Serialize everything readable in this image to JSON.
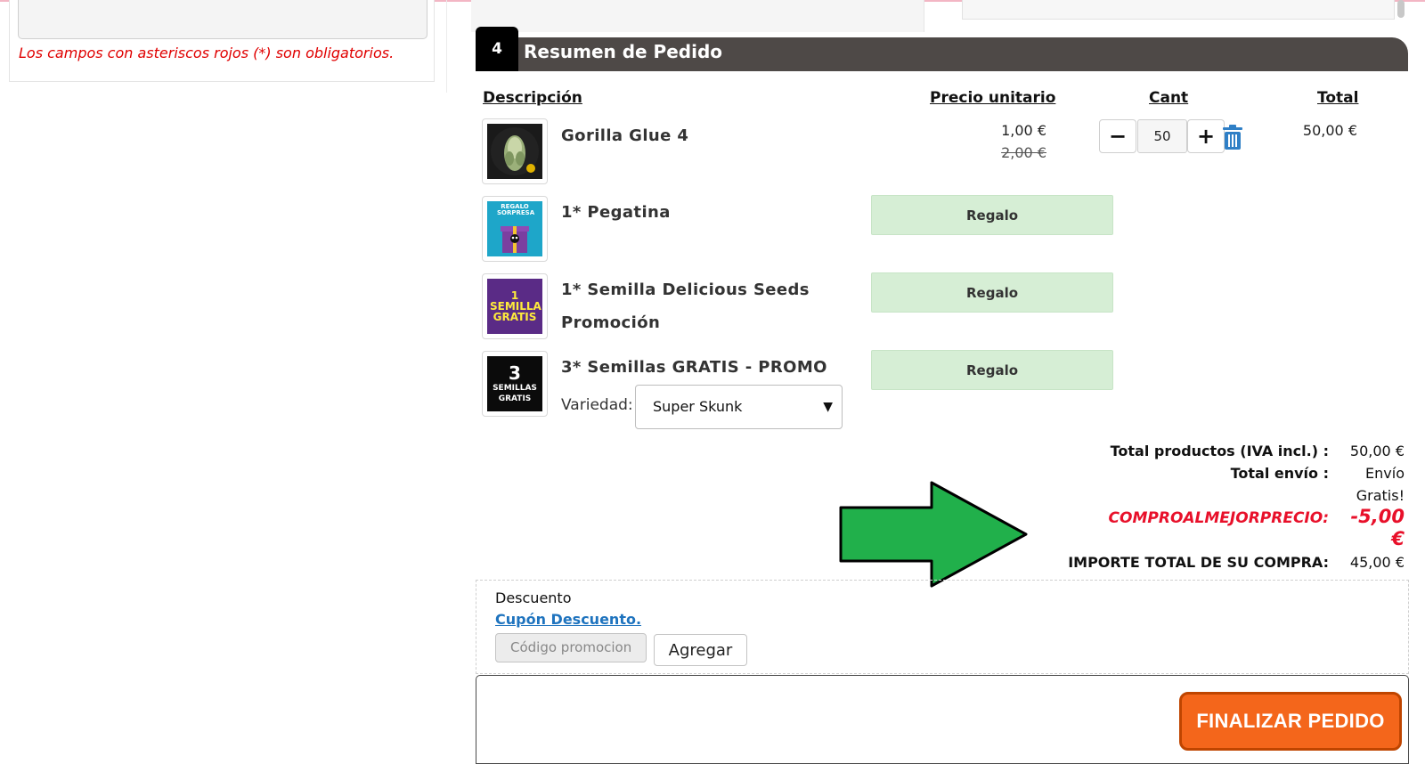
{
  "left": {
    "required_note": "Los campos con asteriscos rojos (*) son obligatorios."
  },
  "section": {
    "step": "4",
    "title": "Resumen de Pedido"
  },
  "table": {
    "headers": {
      "description": "Descripción",
      "unit_price": "Precio unitario",
      "qty": "Cant",
      "total": "Total"
    }
  },
  "items": [
    {
      "name": "Gorilla Glue 4",
      "price": "1,00 €",
      "old_price": "2,00 €",
      "qty": "50",
      "total": "50,00 €"
    },
    {
      "name": "1* Pegatina",
      "gift": "Regalo",
      "thumb_text": "REGALO SORPRESA"
    },
    {
      "name": "1* Semilla Delicious Seeds",
      "name_line2": "Promoción",
      "gift": "Regalo",
      "thumb_text": "1 SEMILLA GRATIS"
    },
    {
      "name": "3* Semillas GRATIS - PROMO",
      "gift": "Regalo",
      "thumb_text_1": "3",
      "thumb_text_2": "SEMILLAS",
      "thumb_text_3": "GRATIS"
    }
  ],
  "variety": {
    "label": "Variedad:",
    "selected": "Super Skunk"
  },
  "totals": {
    "products_label": "Total productos  (IVA incl.) :",
    "products_value": "50,00 €",
    "shipping_label": "Total envío :",
    "shipping_value_1": "Envío",
    "shipping_value_2": "Gratis!",
    "promo_label": "COMPROALMEJORPRECIO:",
    "promo_value_1": "-5,00",
    "promo_value_2": "€",
    "grand_label": "IMPORTE TOTAL DE SU COMPRA:",
    "grand_value": "45,00 €"
  },
  "discount": {
    "title": "Descuento",
    "coupon_link": "Cupón Descuento.",
    "input_placeholder": "Código promocion",
    "add_label": "Agregar"
  },
  "finish": {
    "label": "FINALIZAR PEDIDO"
  },
  "icons": {
    "minus": "minus-icon",
    "plus": "plus-icon",
    "trash": "trash-icon",
    "chevron": "chevron-down-icon",
    "arrow": "arrow-right-icon"
  },
  "colors": {
    "header_bg": "#4e4947",
    "gift_bg": "#d6eed5",
    "promo_red": "#e8102a",
    "finish_orange": "#f4661b",
    "link_blue": "#1e73be",
    "arrow_green": "#21b04b"
  }
}
